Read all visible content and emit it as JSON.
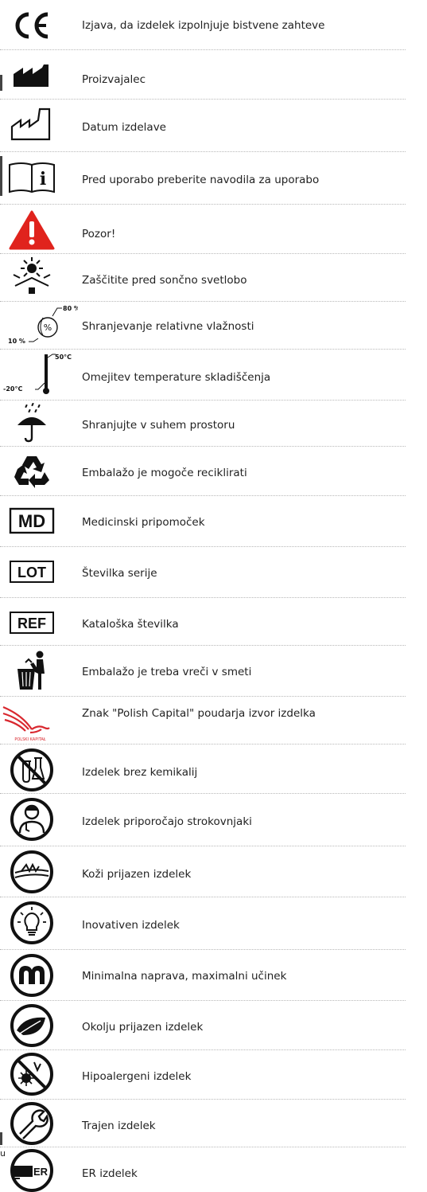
{
  "rows": [
    {
      "icon": "ce-mark-icon",
      "label": "Izjava, da izdelek izpolnjuje bistvene zahteve"
    },
    {
      "icon": "manufacturer-icon",
      "label": "Proizvajalec"
    },
    {
      "icon": "date-of-manufacture-icon",
      "label": "Datum izdelave"
    },
    {
      "icon": "consult-instructions-icon",
      "label": "Pred uporabo preberite navodila za uporabo"
    },
    {
      "icon": "warning-icon",
      "label": "Pozor!"
    },
    {
      "icon": "keep-away-from-sunlight-icon",
      "label": "Zaščitite pred sončno svetlobo"
    },
    {
      "icon": "humidity-limit-icon",
      "label": "Shranjevanje relativne vlažnosti"
    },
    {
      "icon": "temperature-limit-icon",
      "label": "Omejitev temperature skladiščenja"
    },
    {
      "icon": "keep-dry-icon",
      "label": "Shranjujte v suhem prostoru"
    },
    {
      "icon": "recycling-icon",
      "label": "Embalažo je mogoče reciklirati"
    },
    {
      "icon": "medical-device-icon",
      "label": "Medicinski pripomoček"
    },
    {
      "icon": "lot-icon",
      "label": "Številka serije"
    },
    {
      "icon": "ref-icon",
      "label": "Kataloška številka"
    },
    {
      "icon": "tidy-man-icon",
      "label": "Embalažo je treba vreči v smeti"
    },
    {
      "icon": "polish-capital-logo",
      "label": "Znak \"Polish Capital\" poudarja izvor izdelka"
    },
    {
      "icon": "chemical-free-icon",
      "label": "Izdelek brez kemikalij"
    },
    {
      "icon": "expert-recommended-icon",
      "label": "Izdelek priporočajo strokovnjaki"
    },
    {
      "icon": "skin-friendly-icon",
      "label": "Koži prijazen izdelek"
    },
    {
      "icon": "innovative-icon",
      "label": "Inovativen izdelek"
    },
    {
      "icon": "minimal-device-icon",
      "label": "Minimalna naprava, maximalni učinek"
    },
    {
      "icon": "eco-friendly-icon",
      "label": "Okolju prijazen izdelek"
    },
    {
      "icon": "hypoallergenic-icon",
      "label": "Hipoalergeni izdelek"
    },
    {
      "icon": "durable-icon",
      "label": "Trajen izdelek"
    },
    {
      "icon": "er-icon",
      "label": "ER izdelek"
    }
  ],
  "icon_text": {
    "humidity_max": "80 %",
    "humidity_min": "10 %",
    "humidity_symbol": "%",
    "temp_max": "50°C",
    "temp_min": "-20°C",
    "md": "MD",
    "lot": "LOT",
    "ref": "REF",
    "polish_capital": "POLSKI KAPITAŁ",
    "er": "ER"
  },
  "colors": {
    "warning_red": "#e0231d",
    "polish_capital_red": "#d9282f"
  },
  "stray_text": "u"
}
